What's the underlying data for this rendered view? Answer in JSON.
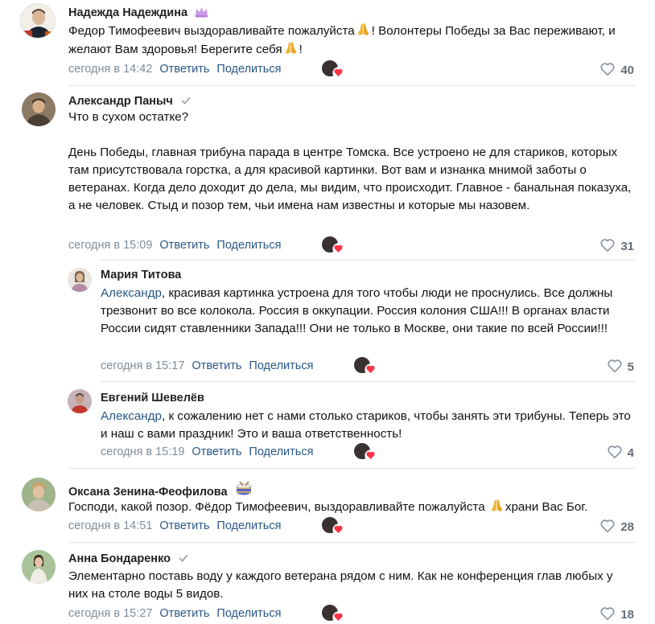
{
  "ui": {
    "like_icon": "heart-outline-icon",
    "liker_icon": "heart-filled-icon",
    "colors": {
      "link": "#2a5885",
      "meta": "#818c99",
      "heart": "#ff3347",
      "divider": "#e4e6ea"
    }
  },
  "comments": [
    {
      "author": "Надежда Надеждина",
      "badge": "crown-icon",
      "text1": "Федор Тимофеевич выздоравливайте пожалуйста",
      "text2": "! Волонтеры Победы за Вас переживают, и желают Вам здоровья! Берегите себя",
      "text3": "!",
      "time": "сегодня в 14:42",
      "reply": "Ответить",
      "share": "Поделиться",
      "likes": "40"
    },
    {
      "author": "Александр Паныч",
      "badge": "check-icon",
      "text1": "Что в сухом остатке?",
      "text2": "День Победы, главная трибуна парада в центре Томска. Все устроено не для стариков, которых там присутствовала горстка, а для красивой картинки. Вот вам и изнанка мнимой заботы о ветеранах. Когда дело доходит до дела, мы видим, что происходит. Главное - банальная показуха, а не человек. Стыд и позор тем, чьи имена нам известны и которые мы назовем.",
      "time": "сегодня в 15:09",
      "reply": "Ответить",
      "share": "Поделиться",
      "likes": "31"
    },
    {
      "author": "Мария Титова",
      "address": "Александр",
      "text1": ", красивая картинка устроена для того чтобы люди не проснулись. Все должны трезвонит во все колокола. Россия в оккупации. Россия колония США!!! В органах власти России сидят ставленники Запада!!! Они не только в Москве, они такие по всей России!!!",
      "time": "сегодня в 15:17",
      "reply": "Ответить",
      "share": "Поделиться",
      "likes": "5"
    },
    {
      "author": "Евгений Шевелёв",
      "address": "Александр",
      "text1": ", к сожалению нет с нами столько стариков, чтобы занять эти трибуны. Теперь это и наш с вами праздник! Это и ваша ответственность!",
      "time": "сегодня в 15:19",
      "reply": "Ответить",
      "share": "Поделиться",
      "likes": "4"
    },
    {
      "author": "Оксана Зенина-Феофилова",
      "badge": "drum-icon",
      "text1": "Господи, какой позор. Фёдор Тимофеевич, выздоравливайте пожалуйста",
      "text2": "храни Вас Бог.",
      "time": "сегодня в 14:51",
      "reply": "Ответить",
      "share": "Поделиться",
      "likes": "28"
    },
    {
      "author": "Анна Бондаренко",
      "badge": "check-icon",
      "text1": "Элементарно поставь воду у каждого ветерана рядом с ним. Как не конференция глав любых у них на столе воды 5 видов.",
      "time": "сегодня в 15:27",
      "reply": "Ответить",
      "share": "Поделиться",
      "likes": "18"
    }
  ]
}
